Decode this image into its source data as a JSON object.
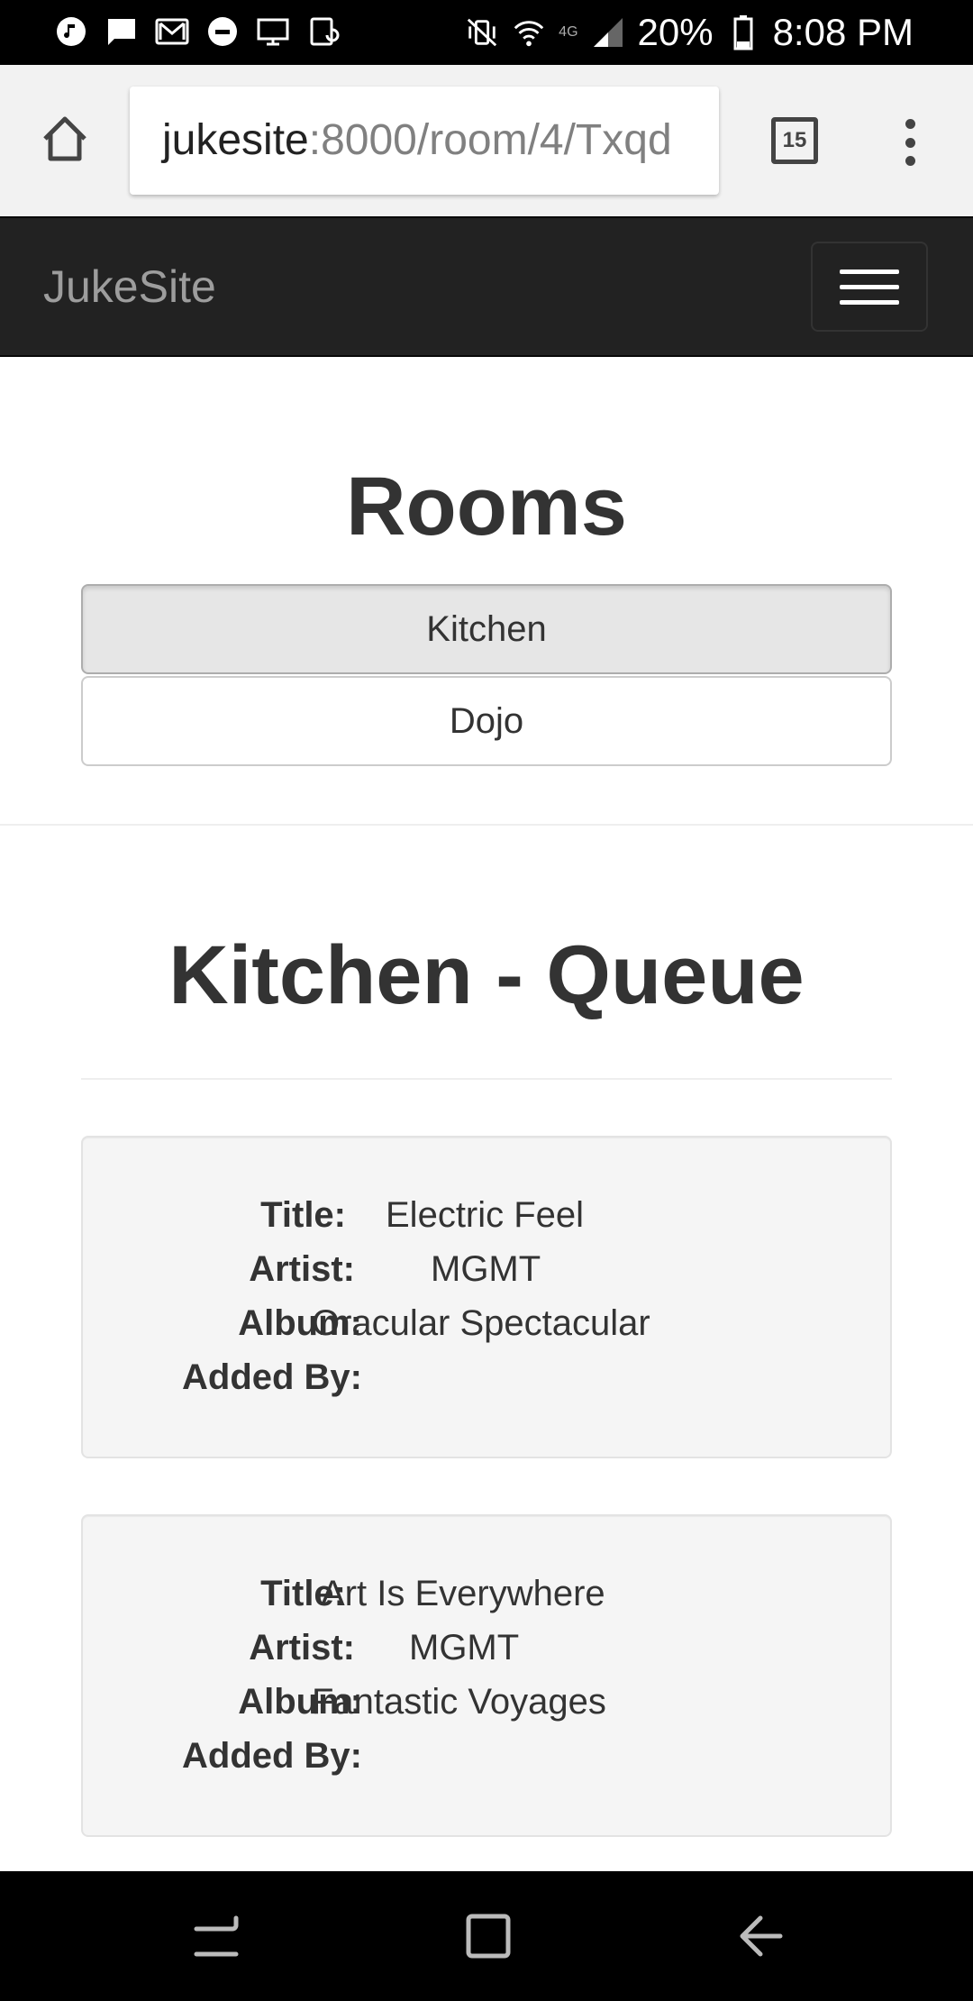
{
  "status_bar": {
    "battery": "20%",
    "time": "8:08 PM",
    "network": "4G"
  },
  "browser": {
    "url_host": "jukesite",
    "url_rest": ":8000/room/4/Txqd",
    "tab_count": "15"
  },
  "navbar": {
    "brand": "JukeSite"
  },
  "rooms": {
    "title": "Rooms",
    "items": [
      {
        "label": "Kitchen",
        "active": true
      },
      {
        "label": "Dojo",
        "active": false
      }
    ]
  },
  "queue": {
    "title": "Kitchen - Queue",
    "labels": {
      "title": "Title:",
      "artist": "Artist:",
      "album": "Album:",
      "added_by": "Added By:"
    },
    "songs": [
      {
        "title": "Electric Feel",
        "artist": "MGMT",
        "album": "Oracular Spectacular",
        "added_by": ""
      },
      {
        "title": "Art Is Everywhere",
        "artist": "MGMT",
        "album": "Fantastic Voyages",
        "added_by": ""
      }
    ]
  },
  "colors": {
    "navbar_bg": "#222222",
    "brand": "#9d9d9d",
    "card_bg": "#f5f5f5",
    "active_button": "#e6e6e6"
  },
  "icons": {
    "status_left": [
      "music-app-icon",
      "message-icon",
      "gmail-icon",
      "uber-icon",
      "screen-icon",
      "update-icon"
    ],
    "status_right": [
      "mute-vibrate-icon",
      "wifi-icon",
      "signal-icon",
      "battery-icon"
    ],
    "browser": [
      "home-icon",
      "tabs-icon",
      "more-vert-icon"
    ],
    "navbar": [
      "hamburger-icon"
    ],
    "bottom_nav": [
      "recents-icon",
      "home-square-icon",
      "back-icon"
    ]
  }
}
